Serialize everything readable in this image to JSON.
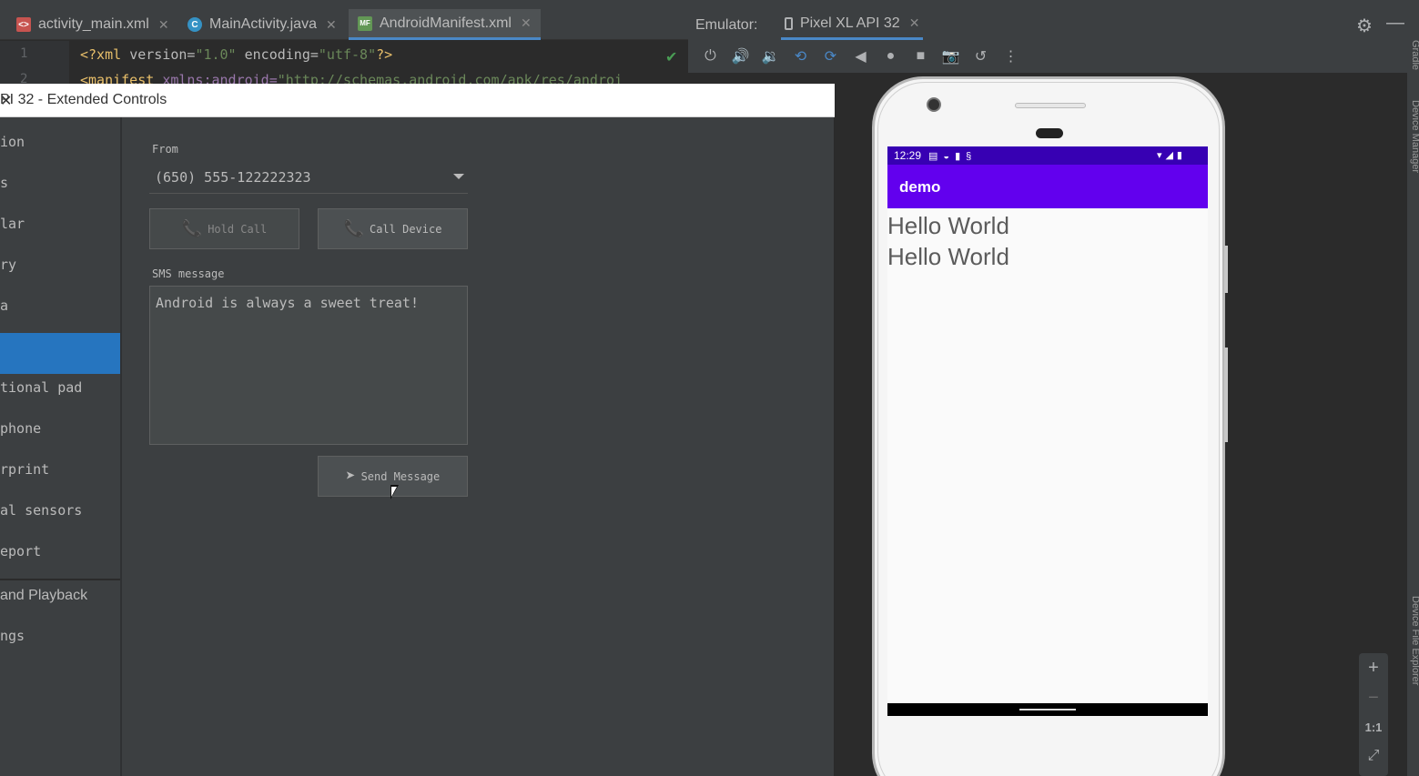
{
  "editor": {
    "tabs": [
      {
        "label": "activity_main.xml",
        "icon": "xml-file-icon"
      },
      {
        "label": "MainActivity.java",
        "icon": "java-class-icon"
      },
      {
        "label": "AndroidManifest.xml",
        "icon": "manifest-file-icon"
      }
    ],
    "active_tab": "AndroidManifest.xml",
    "lines": [
      {
        "number": "1",
        "text": "<?xml version=\"1.0\" encoding=\"utf-8\"?>"
      },
      {
        "number": "2",
        "text": "<manifest xmlns:android=\"http://schemas.android.com/apk/res/androi"
      }
    ],
    "line1": {
      "open": "<?xml ",
      "a1": "version=",
      "v1": "\"1.0\"",
      "a2": " encoding=",
      "v2": "\"utf-8\"",
      "close": "?>"
    },
    "line2": {
      "open": "<manifest ",
      "ns": "xmlns:",
      "attr": "android=",
      "val": "\"http://schemas.android.com/apk/res/androi"
    }
  },
  "emulator": {
    "title": "Emulator:",
    "device_tab": "Pixel XL API 32",
    "toolbar_icons": [
      "power-icon",
      "volume-up-icon",
      "volume-down-icon",
      "rotate-left-icon",
      "rotate-right-icon",
      "back-icon",
      "home-icon",
      "overview-icon",
      "screenshot-icon",
      "snapshot-icon",
      "more-icon"
    ],
    "zoom": {
      "in": "+",
      "out": "−",
      "actual": "1:1"
    }
  },
  "phone": {
    "status_time": "12:29",
    "app_title": "demo",
    "text_lines": [
      "Hello World",
      "Hello World"
    ]
  },
  "extended_controls": {
    "title": "PI 32 - Extended Controls",
    "nav": [
      {
        "label": "ion"
      },
      {
        "label": "s"
      },
      {
        "label": "lar"
      },
      {
        "label": "ry"
      },
      {
        "label": "a"
      },
      {
        "label": ""
      },
      {
        "label": "tional pad"
      },
      {
        "label": "phone"
      },
      {
        "label": "rprint"
      },
      {
        "label": "al sensors"
      },
      {
        "label": "eport"
      },
      {
        "label": " and Playback"
      },
      {
        "label": "ngs"
      }
    ],
    "selected_index": 5,
    "from_label": "From",
    "from_value": "(650) 555-122222323",
    "hold_call": "Hold Call",
    "call_device": "Call Device",
    "sms_label": "SMS message",
    "sms_text": "Android is always a sweet treat!",
    "send_message": "Send Message"
  },
  "side_panel": {
    "top_label": "Gradle",
    "mid_label": "Device Manager",
    "bottom_label": "Device File Explorer"
  }
}
